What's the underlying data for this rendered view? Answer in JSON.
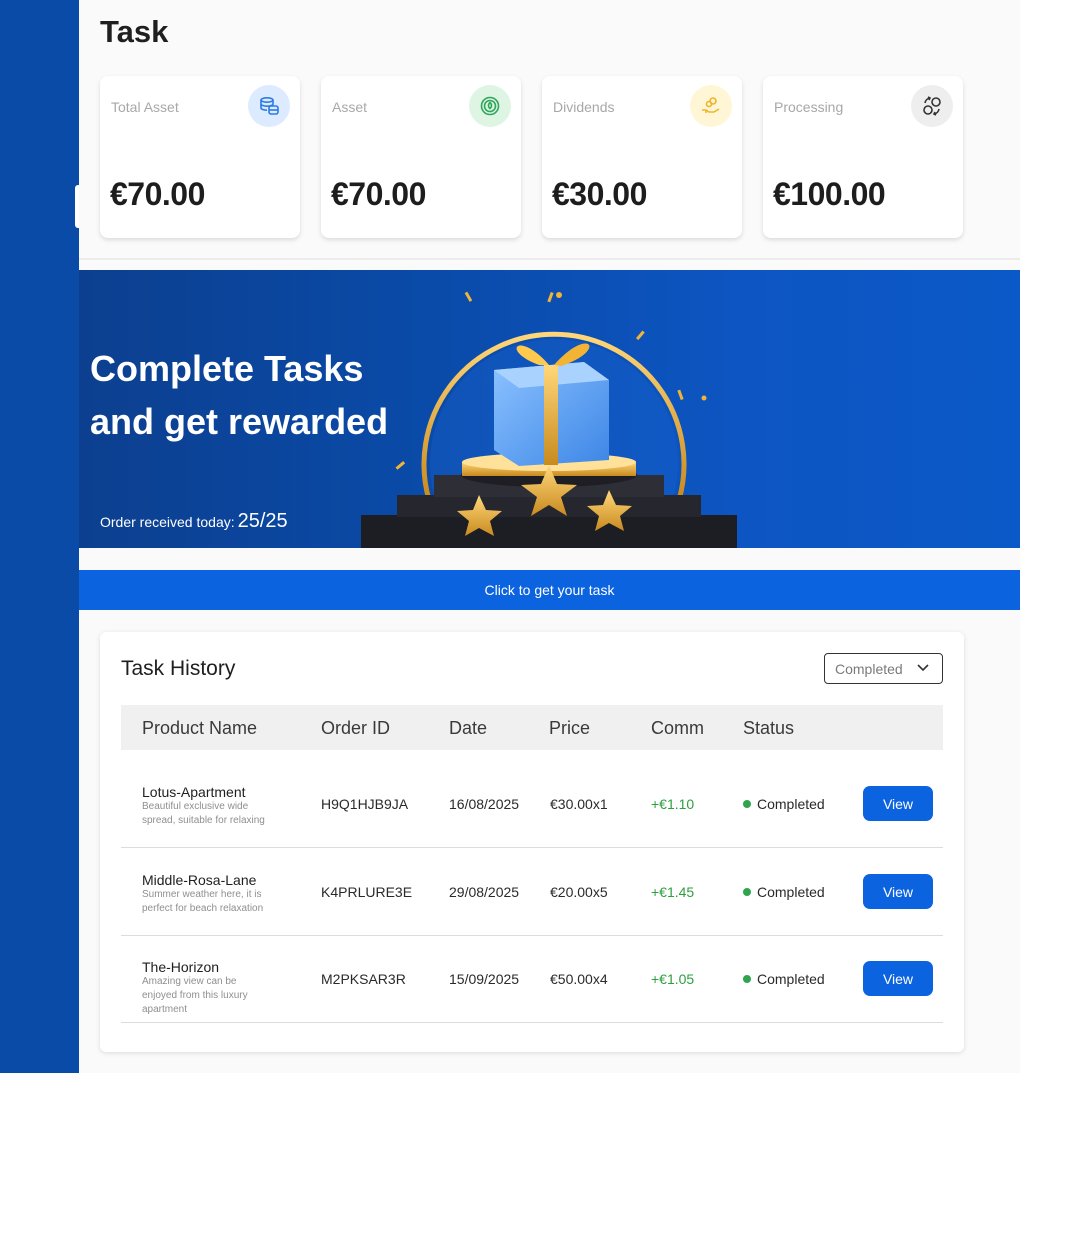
{
  "page": {
    "title": "Task"
  },
  "cards": [
    {
      "label": "Total Asset",
      "value": "€70.00",
      "icon": "coins-stack-icon",
      "accent": "#dcebff"
    },
    {
      "label": "Asset",
      "value": "€70.00",
      "icon": "leaf-coin-icon",
      "accent": "#def5e4"
    },
    {
      "label": "Dividends",
      "value": "€30.00",
      "icon": "hand-coins-icon",
      "accent": "#fff6d6"
    },
    {
      "label": "Processing",
      "value": "€100.00",
      "icon": "exchange-icon",
      "accent": "#eeeeee"
    }
  ],
  "banner": {
    "title_line1": "Complete Tasks",
    "title_line2": "and get rewarded",
    "orders_label": "Order received today:",
    "orders_count": "25/25"
  },
  "cta": {
    "label": "Click to get your task"
  },
  "history": {
    "title": "Task History",
    "filter_value": "Completed",
    "columns": [
      "Product Name",
      "Order ID",
      "Date",
      "Price",
      "Comm",
      "Status"
    ],
    "rows": [
      {
        "name": "Lotus-Apartment",
        "desc": "Beautiful exclusive wide spread, suitable for relaxing",
        "order_id": "H9Q1HJB9JA",
        "date": "16/08/2025",
        "price": "€30.00x1",
        "comm": "+€1.10",
        "status": "Completed",
        "action": "View"
      },
      {
        "name": "Middle-Rosa-Lane",
        "desc": "Summer weather here, it is perfect for beach relaxation",
        "order_id": "K4PRLURE3E",
        "date": "29/08/2025",
        "price": "€20.00x5",
        "comm": "+€1.45",
        "status": "Completed",
        "action": "View"
      },
      {
        "name": "The-Horizon",
        "desc": "Amazing view can be enjoyed from this luxury apartment",
        "order_id": "M2PKSAR3R",
        "date": "15/09/2025",
        "price": "€50.00x4",
        "comm": "+€1.05",
        "status": "Completed",
        "action": "View"
      }
    ]
  },
  "colors": {
    "primary": "#0b63e0",
    "sidebar": "#0a4ba7",
    "positive": "#2e9e3e"
  }
}
